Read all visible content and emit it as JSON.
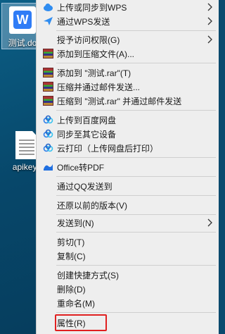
{
  "desktop": {
    "icons": [
      {
        "label": "测试.do",
        "type": "wps-doc"
      },
      {
        "label": "apikey.t",
        "type": "text-file"
      }
    ]
  },
  "menu": {
    "items": [
      {
        "label": "上传或同步到WPS",
        "icon": "wps-cloud-icon",
        "submenu": true
      },
      {
        "label": "通过WPS发送",
        "icon": "wps-send-icon",
        "submenu": true
      },
      {
        "label": "授予访问权限(G)",
        "icon": "",
        "submenu": true
      },
      {
        "label": "添加到压缩文件(A)...",
        "icon": "winrar-icon",
        "submenu": false
      },
      {
        "label": "添加到 \"测试.rar\"(T)",
        "icon": "winrar-icon",
        "submenu": false
      },
      {
        "label": "压缩并通过邮件发送...",
        "icon": "winrar-icon",
        "submenu": false
      },
      {
        "label": "压缩到 \"测试.rar\" 并通过邮件发送",
        "icon": "winrar-icon",
        "submenu": false
      },
      {
        "label": "上传到百度网盘",
        "icon": "baidu-cloud-icon",
        "submenu": false
      },
      {
        "label": "同步至其它设备",
        "icon": "baidu-cloud-icon",
        "submenu": false
      },
      {
        "label": "云打印（上传网盘后打印）",
        "icon": "baidu-cloud-icon",
        "submenu": false
      },
      {
        "label": "Office转PDF",
        "icon": "office-pdf-icon",
        "submenu": false
      },
      {
        "label": "通过QQ发送到",
        "icon": "",
        "submenu": false
      },
      {
        "label": "还原以前的版本(V)",
        "icon": "",
        "submenu": false
      },
      {
        "label": "发送到(N)",
        "icon": "",
        "submenu": true
      },
      {
        "label": "剪切(T)",
        "icon": "",
        "submenu": false
      },
      {
        "label": "复制(C)",
        "icon": "",
        "submenu": false
      },
      {
        "label": "创建快捷方式(S)",
        "icon": "",
        "submenu": false
      },
      {
        "label": "删除(D)",
        "icon": "",
        "submenu": false
      },
      {
        "label": "重命名(M)",
        "icon": "",
        "submenu": false
      },
      {
        "label": "属性(R)",
        "icon": "",
        "submenu": false
      }
    ],
    "highlighted_item": "属性(R)",
    "highlight_color": "#e02020"
  }
}
